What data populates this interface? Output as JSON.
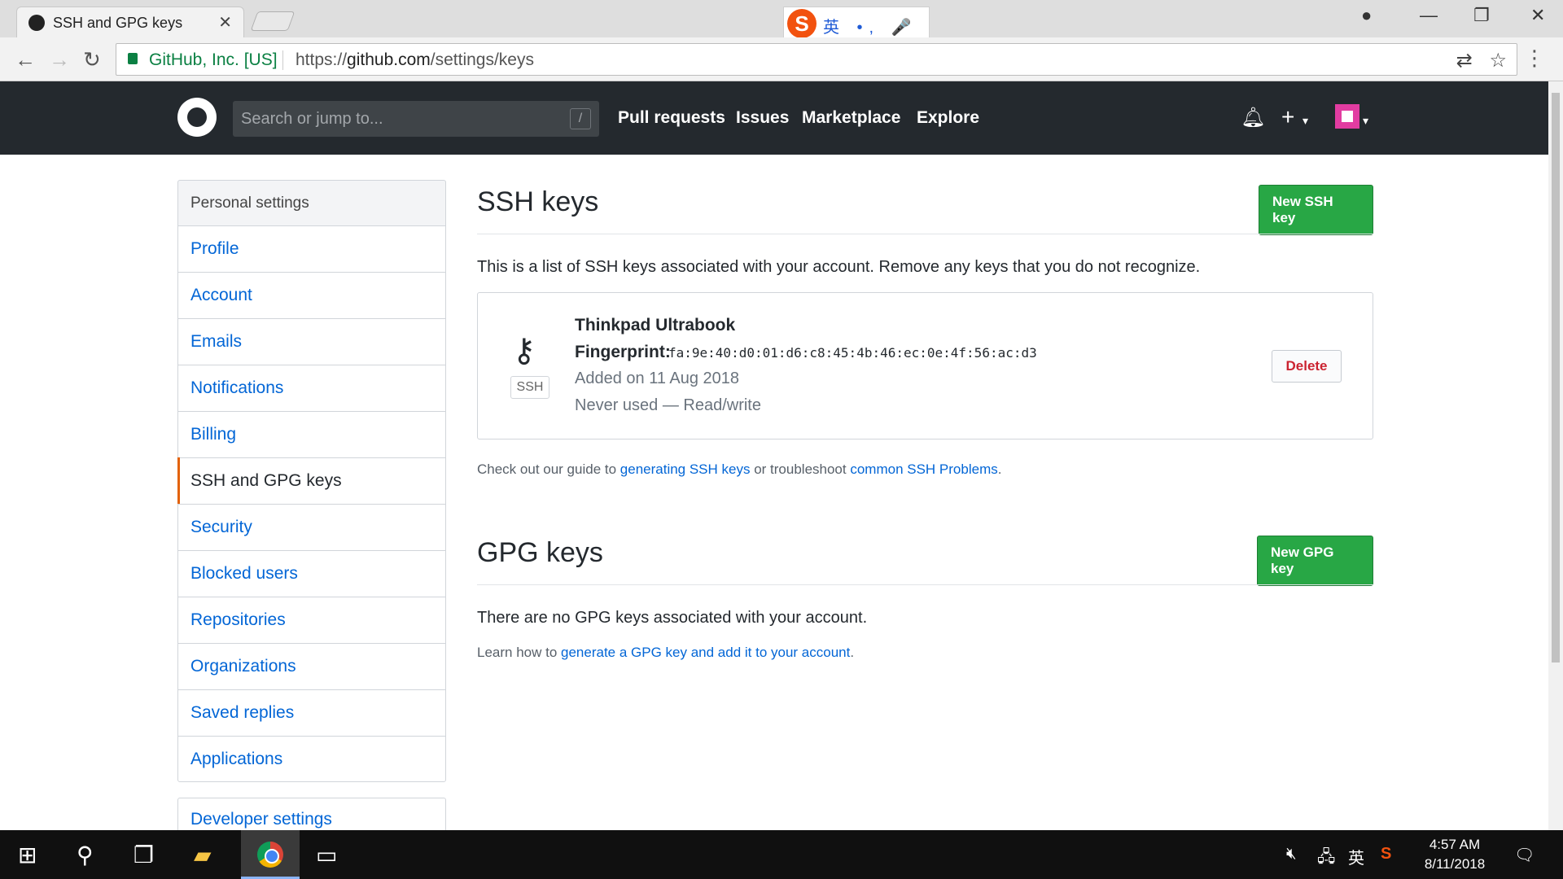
{
  "browser": {
    "tab_title": "SSH and GPG keys",
    "tab_close": "✕",
    "secure_label": "GitHub, Inc. [US]",
    "url_scheme": "https://",
    "url_host": "github.com",
    "url_path": "/settings/keys",
    "ime_text": "英 •, 🎤 ⌨"
  },
  "header": {
    "search_placeholder": "Search or jump to...",
    "search_shortcut": "/",
    "nav": [
      "Pull requests",
      "Issues",
      "Marketplace",
      "Explore"
    ],
    "plus": "+",
    "caret": "▾"
  },
  "sidebar": {
    "title": "Personal settings",
    "items": [
      {
        "label": "Profile"
      },
      {
        "label": "Account"
      },
      {
        "label": "Emails"
      },
      {
        "label": "Notifications"
      },
      {
        "label": "Billing"
      },
      {
        "label": "SSH and GPG keys",
        "active": true
      },
      {
        "label": "Security"
      },
      {
        "label": "Blocked users"
      },
      {
        "label": "Repositories"
      },
      {
        "label": "Organizations"
      },
      {
        "label": "Saved replies"
      },
      {
        "label": "Applications"
      }
    ],
    "developer_settings": "Developer settings"
  },
  "ssh": {
    "title": "SSH keys",
    "new_button": "New SSH key",
    "intro": "This is a list of SSH keys associated with your account. Remove any keys that you do not recognize.",
    "key": {
      "type_label": "SSH",
      "name": "Thinkpad Ultrabook",
      "fingerprint_label": "Fingerprint:",
      "fingerprint": "fa:9e:40:d0:01:d6:c8:45:4b:46:ec:0e:4f:56:ac:d3",
      "added": "Added on 11 Aug 2018",
      "usage": "Never used — Read/write",
      "delete_label": "Delete"
    },
    "guide_prefix": "Check out our guide to ",
    "guide_link1": "generating SSH keys",
    "guide_middle": " or troubleshoot ",
    "guide_link2": "common SSH Problems",
    "guide_suffix": "."
  },
  "gpg": {
    "title": "GPG keys",
    "new_button": "New GPG key",
    "empty_text": "There are no GPG keys associated with your account.",
    "learn_prefix": "Learn how to ",
    "learn_link": "generate a GPG key and add it to your account",
    "learn_suffix": "."
  },
  "taskbar": {
    "tray_ime": "英",
    "time": "4:57 AM",
    "date": "8/11/2018"
  },
  "colors": {
    "header_bg": "#24292e",
    "link": "#0366d6",
    "green": "#28a745",
    "danger": "#cb2431",
    "active_marker": "#e36209"
  }
}
